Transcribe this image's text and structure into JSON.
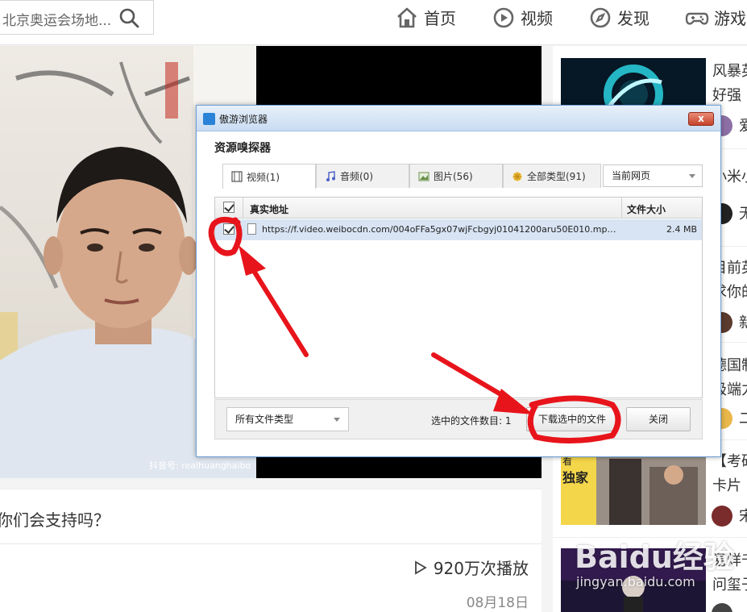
{
  "search": {
    "value": "北京奥运会场地..."
  },
  "nav": [
    {
      "label": "首页",
      "icon": "home-icon"
    },
    {
      "label": "视频",
      "icon": "play-circle-icon"
    },
    {
      "label": "发现",
      "icon": "compass-icon"
    },
    {
      "label": "游戏",
      "icon": "gamepad-icon"
    }
  ],
  "video": {
    "watermark": "抖音号: realhuanghaibo"
  },
  "post": {
    "title": "你们会支持吗？",
    "plays": "920万次播放",
    "date": "08月18日"
  },
  "recommendations": [
    {
      "line1": "风暴英",
      "line2": "好强",
      "avatar_tail": "爱"
    },
    {
      "line1": "小米小",
      "avatar_tail": "无"
    },
    {
      "line1": "目前英",
      "line2": "求你的",
      "avatar_tail": "新"
    },
    {
      "line1": "德国制",
      "line2": "极端力",
      "avatar_tail": "二"
    },
    {
      "line1": "【考研",
      "line2": "卡片",
      "avatar_tail": "宋"
    },
    {
      "line1": "易烊千",
      "line2": "问玺子",
      "avatar_tail": ""
    }
  ],
  "rec_thumb": {
    "badge_top": "看",
    "badge_main": "独家"
  },
  "baidu_watermark": {
    "main": "Baidu经验",
    "sub": "jingyan.baidu.com"
  },
  "dialog": {
    "window_title": "傲游浏览器",
    "close_label": "x",
    "heading": "资源嗅探器",
    "tabs": [
      {
        "label": "视频(1)",
        "icon": "film-icon",
        "active": true
      },
      {
        "label": "音频(0)",
        "icon": "music-note-icon",
        "active": false
      },
      {
        "label": "图片(56)",
        "icon": "image-icon",
        "active": false
      },
      {
        "label": "全部类型(91)",
        "icon": "asterisk-icon",
        "active": false
      }
    ],
    "scope": "当前网页",
    "columns": {
      "url": "真实地址",
      "size": "文件大小"
    },
    "rows": [
      {
        "checked": true,
        "url": "https://f.video.weibocdn.com/004oFFa5gx07wjFcbgyj01041200aru50E010.mp4?lab...",
        "size": "2.4 MB"
      }
    ],
    "filter": "所有文件类型",
    "selected_count": "选中的文件数目: 1",
    "download_button": "下载选中的文件",
    "close_button": "关闭"
  },
  "colors": {
    "annotation": "#e8141b",
    "dialog_border": "#6d9fd6",
    "selected_row": "#d8e4f3"
  }
}
